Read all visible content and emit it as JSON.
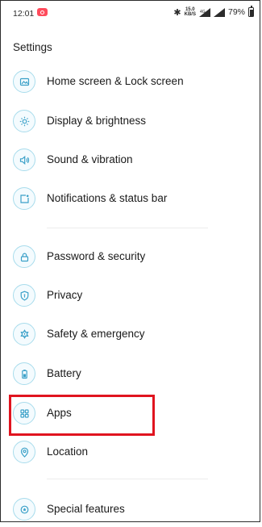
{
  "status_bar": {
    "time": "12:01",
    "speed_top": "15.0",
    "speed_bottom": "KB/S",
    "network": "4G",
    "battery_percent": "79%"
  },
  "header": {
    "title": "Settings"
  },
  "items": [
    {
      "label": "Home screen & Lock screen",
      "icon": "wallpaper-icon"
    },
    {
      "label": "Display & brightness",
      "icon": "brightness-icon"
    },
    {
      "label": "Sound & vibration",
      "icon": "speaker-icon"
    },
    {
      "label": "Notifications & status bar",
      "icon": "notification-icon"
    },
    {
      "label": "Password & security",
      "icon": "lock-icon"
    },
    {
      "label": "Privacy",
      "icon": "shield-icon"
    },
    {
      "label": "Safety & emergency",
      "icon": "emergency-icon"
    },
    {
      "label": "Battery",
      "icon": "battery-icon"
    },
    {
      "label": "Apps",
      "icon": "apps-grid-icon"
    },
    {
      "label": "Location",
      "icon": "location-pin-icon"
    },
    {
      "label": "Special features",
      "icon": "star-icon"
    }
  ],
  "colors": {
    "icon_ring": "#a8dcec",
    "icon_stroke": "#3aa0c8",
    "highlight": "#e0141f"
  }
}
